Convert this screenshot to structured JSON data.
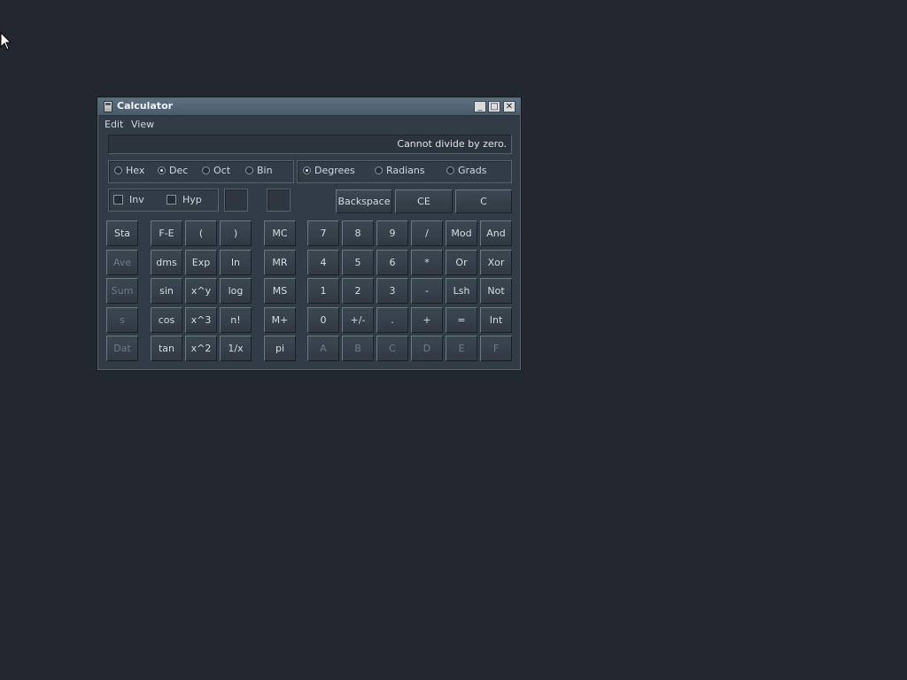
{
  "window": {
    "title": "Calculator",
    "minimize": "_",
    "maximize": "□",
    "close": "✕"
  },
  "menu": [
    "Edit",
    "View"
  ],
  "display": "Cannot divide by zero.",
  "base_options": [
    {
      "label": "Hex",
      "selected": false
    },
    {
      "label": "Dec",
      "selected": true
    },
    {
      "label": "Oct",
      "selected": false
    },
    {
      "label": "Bin",
      "selected": false
    }
  ],
  "angle_options": [
    {
      "label": "Degrees",
      "selected": true
    },
    {
      "label": "Radians",
      "selected": false
    },
    {
      "label": "Grads",
      "selected": false
    }
  ],
  "checkboxes": [
    {
      "label": "Inv",
      "checked": false
    },
    {
      "label": "Hyp",
      "checked": false
    }
  ],
  "edit_buttons": [
    "Backspace",
    "CE",
    "C"
  ],
  "rows": [
    [
      "Sta",
      "F-E",
      "(",
      ")",
      "MC",
      "7",
      "8",
      "9",
      "/",
      "Mod",
      "And"
    ],
    [
      "Ave",
      "dms",
      "Exp",
      "ln",
      "MR",
      "4",
      "5",
      "6",
      "*",
      "Or",
      "Xor"
    ],
    [
      "Sum",
      "sin",
      "x^y",
      "log",
      "MS",
      "1",
      "2",
      "3",
      "-",
      "Lsh",
      "Not"
    ],
    [
      "s",
      "cos",
      "x^3",
      "n!",
      "M+",
      "0",
      "+/-",
      ".",
      "+",
      "=",
      "Int"
    ],
    [
      "Dat",
      "tan",
      "x^2",
      "1/x",
      "pi",
      "A",
      "B",
      "C",
      "D",
      "E",
      "F"
    ]
  ],
  "disabled_buttons": [
    "Ave",
    "Sum",
    "s",
    "Dat",
    "A",
    "B",
    "C",
    "D",
    "E",
    "F"
  ],
  "colors": {
    "desktop": "#232730",
    "window": "#323c46",
    "titlebar": "#56697b",
    "text": "#d0d6dc",
    "disabled_text": "#6e7a86"
  }
}
